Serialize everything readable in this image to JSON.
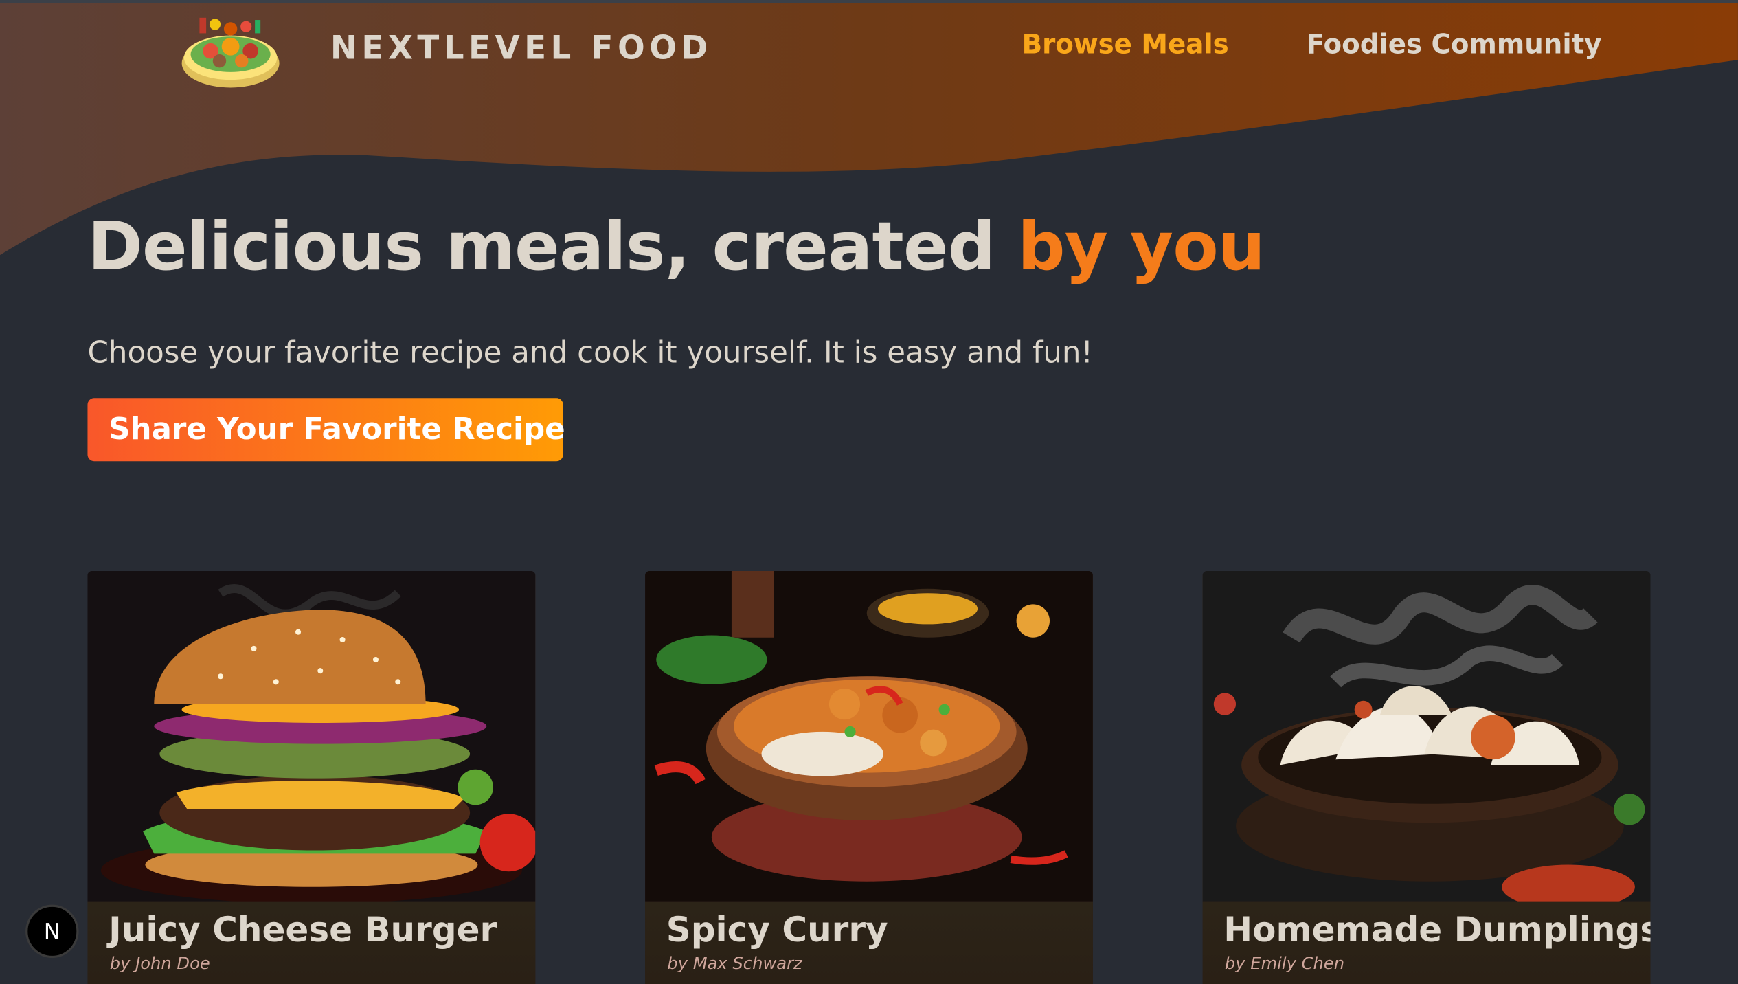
{
  "header": {
    "logo_text": "NEXTLEVEL FOOD",
    "logo_icon": "food-platter-logo",
    "nav": [
      {
        "label": "Browse Meals",
        "active": true
      },
      {
        "label": "Foodies Community",
        "active": false
      }
    ]
  },
  "hero": {
    "title_main": "Delicious meals, created",
    "title_accent": "by you",
    "subtitle": "Choose your favorite recipe and cook it yourself. It is easy and fun!",
    "cta_label": "Share Your Favorite Recipe"
  },
  "meals": [
    {
      "title": "Juicy Cheese Burger",
      "author": "by John Doe",
      "image": "burger-photo"
    },
    {
      "title": "Spicy Curry",
      "author": "by Max Schwarz",
      "image": "curry-photo"
    },
    {
      "title": "Homemade Dumplings",
      "author": "by Emily Chen",
      "image": "dumplings-photo"
    }
  ],
  "dev_badge": {
    "label": "N",
    "icon": "nextjs-icon"
  },
  "colors": {
    "background": "#282c34",
    "accent_orange": "#f57c1a",
    "nav_active": "#f9a61a",
    "cta_start": "#f9572a",
    "cta_end": "#ff9b05",
    "text": "#ddd6cb"
  }
}
